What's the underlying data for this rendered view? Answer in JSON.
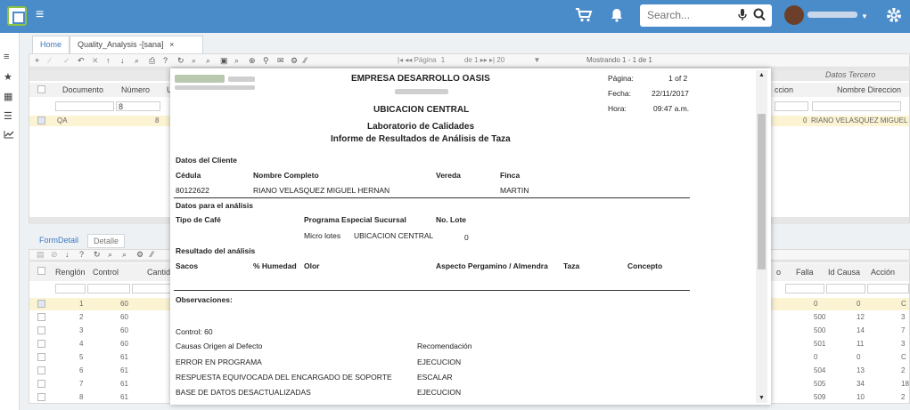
{
  "topbar": {
    "search_placeholder": "Search...",
    "colors": {
      "bar": "#4a8cc9",
      "logo_accent": "#8dc43f"
    }
  },
  "tabs": {
    "home": "Home",
    "active": "Quality_Analysis -[sana]",
    "close": "×"
  },
  "toolbar": {
    "page_label": "Página",
    "page_value": "1",
    "of_label": "de 1",
    "page_size": "20",
    "showing": "Mostrando 1 - 1 de 1"
  },
  "grid1": {
    "group_header": "Datos Tercero",
    "headers": {
      "documento": "Documento",
      "numero": "Número",
      "u": "U",
      "direccion": "ccion",
      "nombre_direccion": "Nombre Direccion"
    },
    "filter_numero": "8",
    "row": {
      "documento": "QA",
      "numero": "8",
      "zero": "0",
      "nombre": "RIANO VELASQUEZ MIGUEL"
    }
  },
  "lower_tabs": {
    "form": "FormDetail",
    "detalle": "Detalle"
  },
  "grid2": {
    "headers": {
      "renglon": "Renglón",
      "control": "Control",
      "cantid": "Cantid",
      "o": "o",
      "falla": "Falla",
      "id_causa": "Id Causa",
      "accion": "Acción"
    },
    "rows": [
      {
        "renglon": "1",
        "control": "60",
        "falla": "0",
        "id_causa": "0",
        "accion": "C"
      },
      {
        "renglon": "2",
        "control": "60",
        "falla": "500",
        "id_causa": "12",
        "accion": "3"
      },
      {
        "renglon": "3",
        "control": "60",
        "falla": "500",
        "id_causa": "14",
        "accion": "7"
      },
      {
        "renglon": "4",
        "control": "60",
        "falla": "501",
        "id_causa": "11",
        "accion": "3"
      },
      {
        "renglon": "5",
        "control": "61",
        "falla": "0",
        "id_causa": "0",
        "accion": "C"
      },
      {
        "renglon": "6",
        "control": "61",
        "falla": "504",
        "id_causa": "13",
        "accion": "2"
      },
      {
        "renglon": "7",
        "control": "61",
        "falla": "505",
        "id_causa": "34",
        "accion": "18"
      },
      {
        "renglon": "8",
        "control": "61",
        "falla": "509",
        "id_causa": "10",
        "accion": "2"
      }
    ]
  },
  "report": {
    "company": "EMPRESA DESARROLLO OASIS",
    "pagina_label": "Página:",
    "pagina_value": "1 of 2",
    "fecha_label": "Fecha:",
    "fecha_value": "22/11/2017",
    "hora_label": "Hora:",
    "hora_value": "09:47 a.m.",
    "location": "UBICACION CENTRAL",
    "lab": "Laboratorio de Calidades",
    "subtitle": "Informe de Resultados de Análisis de Taza",
    "datos_cliente": "Datos del Cliente",
    "cedula_label": "Cédula",
    "nombre_label": "Nombre Completo",
    "vereda_label": "Vereda",
    "finca_label": "Finca",
    "cedula": "80122622",
    "nombre": "RIANO VELASQUEZ MIGUEL HERNAN",
    "finca": "MARTIN",
    "datos_analisis": "Datos para el análisis",
    "tipo_cafe": "Tipo de Café",
    "programa": "Programa Especial Sucursal",
    "lote_label": "No. Lote",
    "micro_lotes": "Micro lotes",
    "sucursal": "UBICACION CENTRAL",
    "lote": "0",
    "resultado": "Resultado del análisis",
    "sacos": "Sacos",
    "humedad": "% Humedad",
    "olor": "Olor",
    "aspecto": "Aspecto Pergamino / Almendra",
    "taza": "Taza",
    "concepto": "Concepto",
    "observaciones": "Observaciones:",
    "control": "Control: 60",
    "causas": "Causas Origen al Defecto",
    "recomendacion": "Recomendación",
    "causa_1": "ERROR EN PROGRAMA",
    "rec_1": "EJECUCION",
    "causa_2": "RESPUESTA EQUIVOCADA DEL ENCARGADO DE SOPORTE",
    "rec_2": "ESCALAR",
    "causa_3": "BASE DE DATOS DESACTUALIZADAS",
    "rec_3": "EJECUCION"
  }
}
